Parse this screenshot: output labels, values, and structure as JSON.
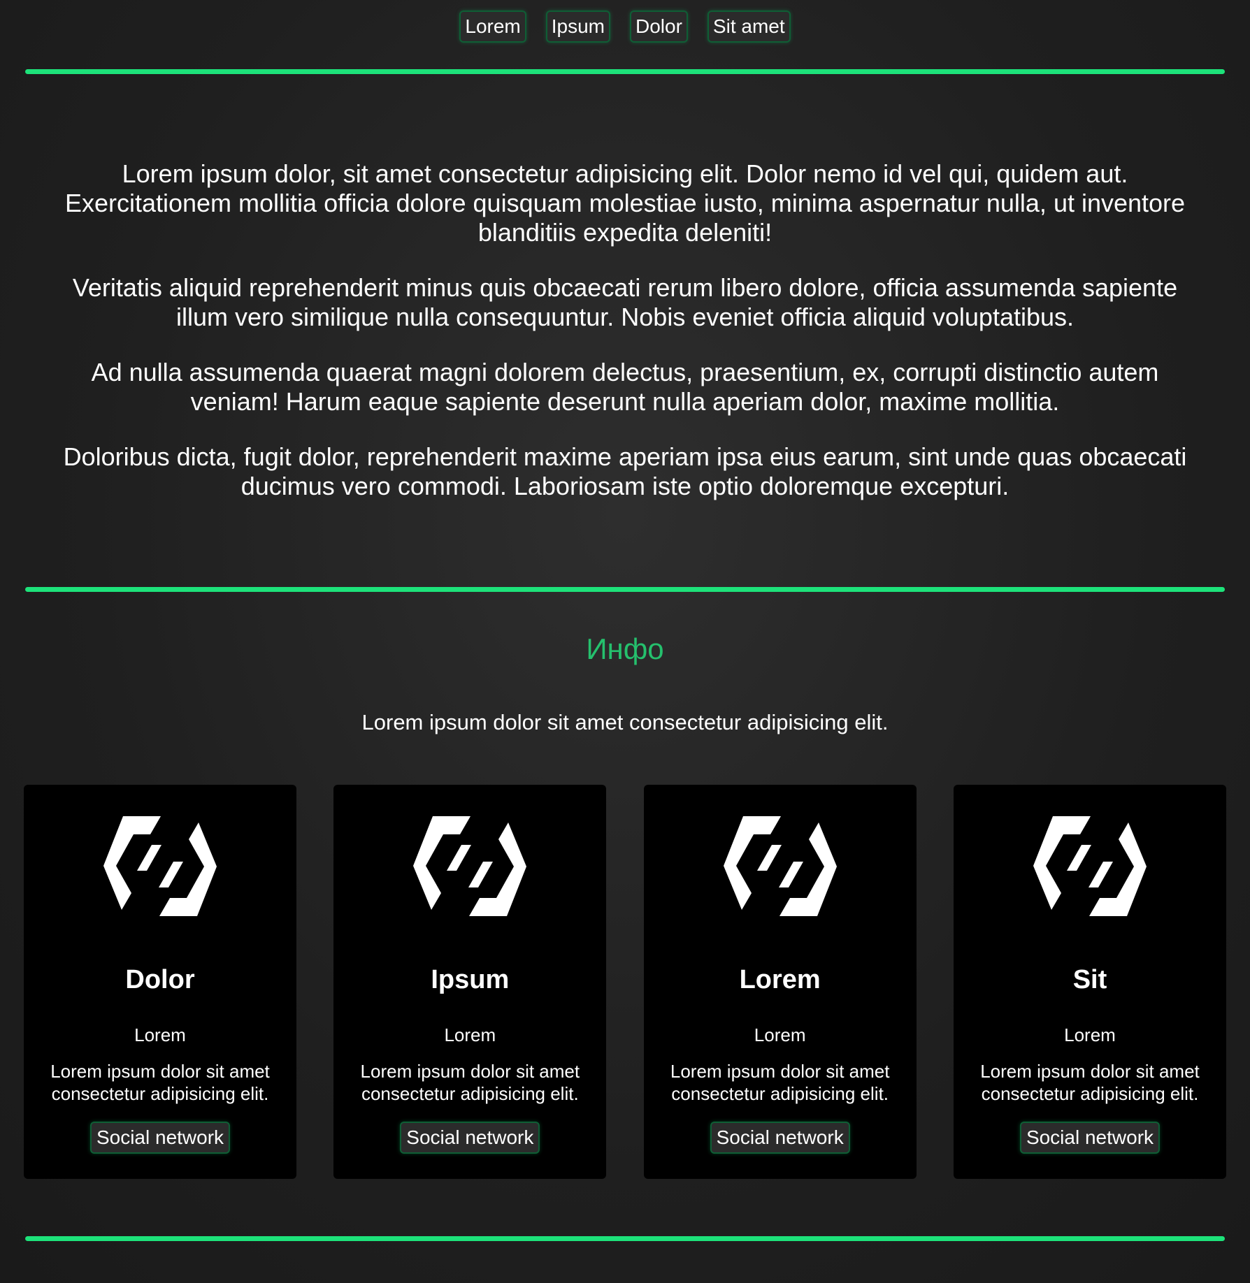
{
  "nav": {
    "items": [
      {
        "label": "Lorem"
      },
      {
        "label": "Ipsum"
      },
      {
        "label": "Dolor"
      },
      {
        "label": "Sit amet"
      }
    ]
  },
  "intro": {
    "paragraphs": [
      "Lorem ipsum dolor, sit amet consectetur adipisicing elit. Dolor nemo id vel qui, quidem aut. Exercitationem mollitia officia dolore quisquam molestiae iusto, minima aspernatur nulla, ut inventore blanditiis expedita deleniti!",
      "Veritatis aliquid reprehenderit minus quis obcaecati rerum libero dolore, officia assumenda sapiente illum vero similique nulla consequuntur. Nobis eveniet officia aliquid voluptatibus.",
      "Ad nulla assumenda quaerat magni dolorem delectus, praesentium, ex, corrupti distinctio autem veniam! Harum eaque sapiente deserunt nulla aperiam dolor, maxime mollitia.",
      "Doloribus dicta, fugit dolor, reprehenderit maxime aperiam ipsa eius earum, sint unde quas obcaecati ducimus vero commodi. Laboriosam iste optio doloremque excepturi."
    ]
  },
  "info": {
    "title": "Инфо",
    "subtitle": "Lorem ipsum dolor sit amet consectetur adipisicing elit."
  },
  "cards": [
    {
      "name": "Dolor",
      "subtitle": "Lorem",
      "text": "Lorem ipsum dolor sit amet consectetur adipisicing elit.",
      "button": "Social network",
      "icon": "logo-icon"
    },
    {
      "name": "Ipsum",
      "subtitle": "Lorem",
      "text": "Lorem ipsum dolor sit amet consectetur adipisicing elit.",
      "button": "Social network",
      "icon": "logo-icon"
    },
    {
      "name": "Lorem",
      "subtitle": "Lorem",
      "text": "Lorem ipsum dolor sit amet consectetur adipisicing elit.",
      "button": "Social network",
      "icon": "logo-icon"
    },
    {
      "name": "Sit",
      "subtitle": "Lorem",
      "text": "Lorem ipsum dolor sit amet consectetur adipisicing elit.",
      "button": "Social network",
      "icon": "logo-icon"
    }
  ],
  "colors": {
    "accent": "#1de27a",
    "title_green": "#25c06d",
    "card_bg": "#000000",
    "page_bg": "#1f1f1f"
  }
}
